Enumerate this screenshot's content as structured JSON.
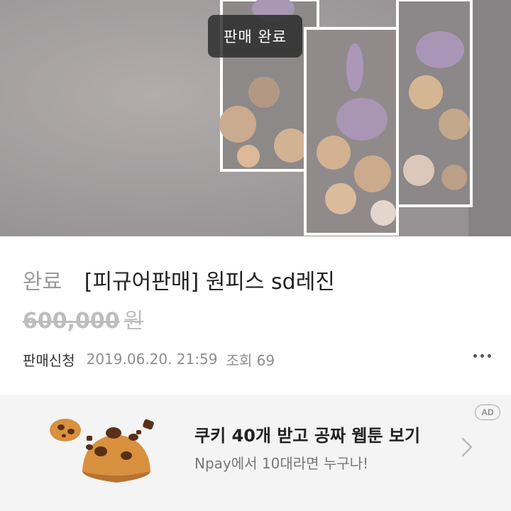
{
  "hero": {
    "sold_badge": "판매 완료",
    "image_subject": "resin figure artwork in frames"
  },
  "product": {
    "status": "완료",
    "title": "[피규어판매] 원피스 sd레진",
    "price_amount": "600,000",
    "price_unit": "원"
  },
  "meta": {
    "apply_label": "판매신청",
    "date": "2019.06.20. 21:59",
    "views": "조회 69"
  },
  "ad": {
    "badge": "AD",
    "title": "쿠키 40개 받고 공짜 웹툰 보기",
    "subtitle": "Npay에서 10대라면 누구나!",
    "image_subject": "cookie-icon"
  },
  "icons": {
    "more": "more-dots-icon",
    "chevron": "chevron-right-icon"
  },
  "colors": {
    "badge_bg": "#282828",
    "price_strike": "#bdbdbd",
    "ad_bg": "#f4f4f4",
    "cookie": "#d9913f",
    "chip": "#5a2f17"
  }
}
